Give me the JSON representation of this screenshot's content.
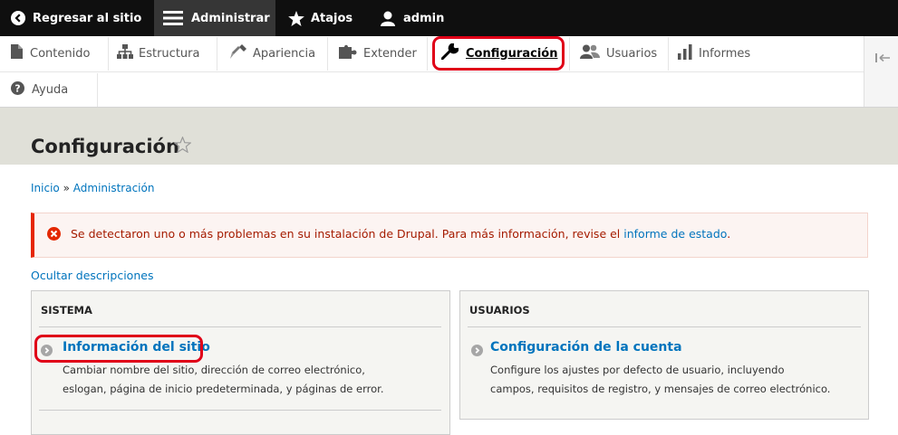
{
  "toolbar": {
    "back_label": "Regresar al sitio",
    "manage_label": "Administrar",
    "shortcuts_label": "Atajos",
    "user_label": "admin"
  },
  "tray": {
    "items": [
      {
        "label": "Contenido",
        "icon": "file-icon"
      },
      {
        "label": "Estructura",
        "icon": "sitemap-icon"
      },
      {
        "label": "Apariencia",
        "icon": "paint-brush-icon"
      },
      {
        "label": "Extender",
        "icon": "puzzle-icon"
      },
      {
        "label": "Configuración",
        "icon": "wrench-icon",
        "active": true
      },
      {
        "label": "Usuarios",
        "icon": "users-icon"
      },
      {
        "label": "Informes",
        "icon": "bar-chart-icon"
      },
      {
        "label": "Ayuda",
        "icon": "question-icon"
      }
    ]
  },
  "page": {
    "title": "Configuración",
    "breadcrumb": [
      "Inicio",
      "Administración"
    ],
    "breadcrumb_sep": "»"
  },
  "error": {
    "text": "Se detectaron uno o más problemas en su instalación de Drupal. Para más información, revise el",
    "link": "informe de estado",
    "suffix": "."
  },
  "hide_descriptions": "Ocultar descripciones",
  "panels": {
    "sistema": {
      "title": "SISTEMA",
      "item_title": "Información del sitio",
      "item_desc_1": "Cambiar nombre del sitio, dirección de correo electrónico,",
      "item_desc_2": "eslogan, página de inicio predeterminada, y páginas de error."
    },
    "usuarios": {
      "title": "USUARIOS",
      "item_title": "Configuración de la cuenta",
      "item_desc_1": "Configure los ajustes por defecto de usuario, incluyendo",
      "item_desc_2": "campos, requisitos de registro, y mensajes de correo electrónico."
    }
  },
  "colors": {
    "link": "#0074bd",
    "error_accent": "#e62600",
    "highlight": "#e00018",
    "toolbar_bg": "#0f0f0f"
  }
}
